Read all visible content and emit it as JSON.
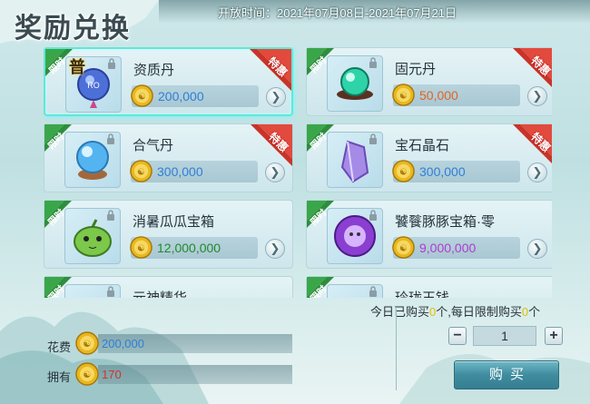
{
  "header": {
    "title": "奖励兑换",
    "open_time": "开放时间：2021年07月08日-2021年07月21日"
  },
  "items": [
    {
      "name": "资质丹",
      "price": "200,000",
      "price_color": "#2f7fd6",
      "badge": "普",
      "limited": "限时",
      "special": "特惠",
      "selected": true,
      "icon": "blue-orb-icon"
    },
    {
      "name": "固元丹",
      "price": "50,000",
      "price_color": "#e0641e",
      "limited": "限时",
      "special": "特惠",
      "icon": "green-orb-icon"
    },
    {
      "name": "合气丹",
      "price": "300,000",
      "price_color": "#2f7fd6",
      "limited": "限时",
      "special": "特惠",
      "icon": "crystal-ball-icon"
    },
    {
      "name": "宝石晶石",
      "price": "300,000",
      "price_color": "#2f7fd6",
      "limited": "限时",
      "special": "特惠",
      "icon": "purple-crystal-icon"
    },
    {
      "name": "消暑瓜瓜宝箱",
      "price": "12,000,000",
      "price_color": "#1f8a2a",
      "limited": "限时",
      "icon": "melon-chest-icon"
    },
    {
      "name": "饕餮豚豚宝箱·零",
      "price": "9,000,000",
      "price_color": "#b03ad0",
      "limited": "限时",
      "icon": "pig-chest-icon"
    },
    {
      "name": "元神精华",
      "limited": "限时",
      "icon": "essence-icon"
    },
    {
      "name": "玲珑玉钱",
      "limited": "限时",
      "icon": "jade-coin-icon"
    }
  ],
  "purchase": {
    "limit_prefix": "今日已购买",
    "bought": "0",
    "limit_mid": "个,每日限制购买",
    "daily_limit": "0",
    "limit_suffix": "个",
    "cost_label": "花费",
    "cost_value": "200,000",
    "own_label": "拥有",
    "own_value": "170",
    "quantity": "1",
    "minus": "−",
    "plus": "+",
    "buy_label": "购买"
  },
  "colors": {
    "cost": "#2f7fd6",
    "own": "#d8322a",
    "limited_ribbon": "#3aa64a",
    "special_ribbon": "#e24a3e"
  }
}
